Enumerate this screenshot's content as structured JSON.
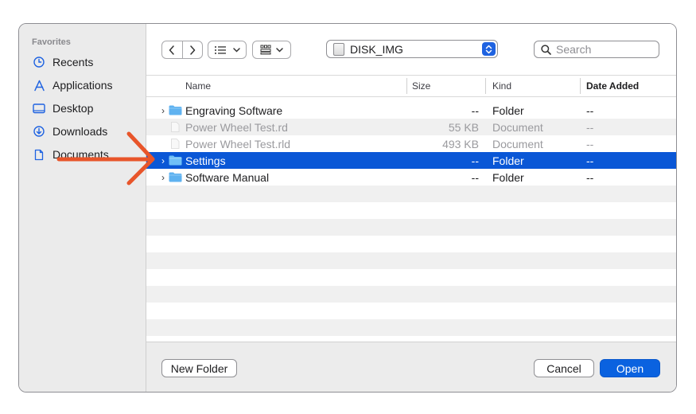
{
  "sidebar": {
    "heading": "Favorites",
    "items": [
      {
        "label": "Recents",
        "icon": "clock-icon"
      },
      {
        "label": "Applications",
        "icon": "applications-icon"
      },
      {
        "label": "Desktop",
        "icon": "desktop-icon"
      },
      {
        "label": "Downloads",
        "icon": "download-icon"
      },
      {
        "label": "Documents",
        "icon": "document-icon"
      }
    ]
  },
  "toolbar": {
    "path_label": "DISK_IMG",
    "search_placeholder": "Search"
  },
  "columns": {
    "name": "Name",
    "size": "Size",
    "kind": "Kind",
    "date": "Date Added"
  },
  "files": [
    {
      "name": "Engraving Software",
      "size": "--",
      "kind": "Folder",
      "date": "--",
      "type": "folder"
    },
    {
      "name": "Power Wheel Test.rd",
      "size": "55 KB",
      "kind": "Document",
      "date": "--",
      "type": "document"
    },
    {
      "name": "Power Wheel Test.rld",
      "size": "493 KB",
      "kind": "Document",
      "date": "--",
      "type": "document"
    },
    {
      "name": "Settings",
      "size": "--",
      "kind": "Folder",
      "date": "--",
      "type": "folder",
      "selected": true
    },
    {
      "name": "Software Manual",
      "size": "--",
      "kind": "Folder",
      "date": "--",
      "type": "folder"
    }
  ],
  "footer": {
    "new_folder_label": "New Folder",
    "cancel_label": "Cancel",
    "open_label": "Open"
  },
  "colors": {
    "selection": "#0a57d6",
    "primary_button": "#0a62e0",
    "folder": "#5fb2f0",
    "annotation_arrow": "#e8552a"
  }
}
